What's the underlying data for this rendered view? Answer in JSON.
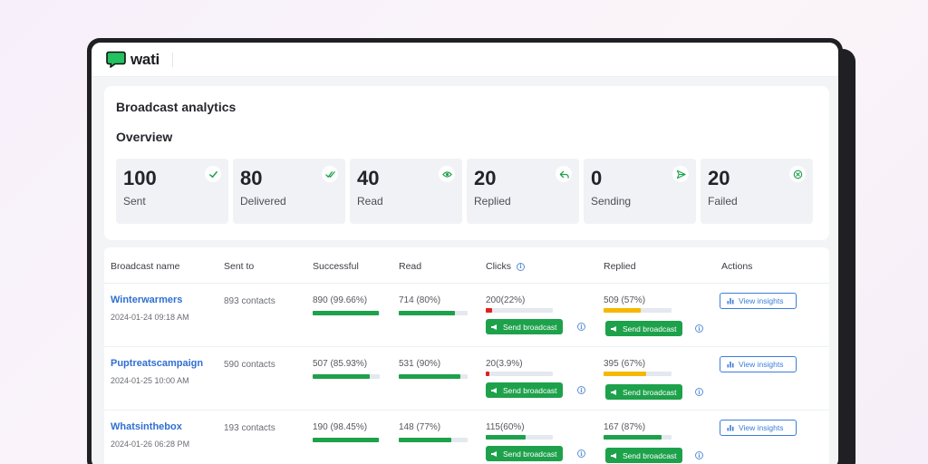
{
  "brand": {
    "name": "wati"
  },
  "page": {
    "title": "Broadcast analytics",
    "overview_title": "Overview"
  },
  "stats": [
    {
      "value": "100",
      "label": "Sent",
      "icon": "check-icon"
    },
    {
      "value": "80",
      "label": "Delivered",
      "icon": "double-check-icon"
    },
    {
      "value": "40",
      "label": "Read",
      "icon": "eye-icon"
    },
    {
      "value": "20",
      "label": "Replied",
      "icon": "reply-icon"
    },
    {
      "value": "0",
      "label": "Sending",
      "icon": "send-icon"
    },
    {
      "value": "20",
      "label": "Failed",
      "icon": "failed-icon"
    }
  ],
  "table": {
    "headers": {
      "name": "Broadcast name",
      "sent_to": "Sent to",
      "successful": "Successful",
      "read": "Read",
      "clicks": "Clicks",
      "replied": "Replied",
      "actions": "Actions"
    },
    "rows": [
      {
        "name": "Winterwarmers",
        "date": "2024-01-24 09:18 AM",
        "sent_to": "893 contacts",
        "successful": "890 (99.66%)",
        "successful_fraction": 0.99,
        "read": "714 (80%)",
        "read_fraction": 0.82,
        "clicks": "200(22%)",
        "clicks_fraction": 0.1,
        "clicks_color": "#e02020",
        "replied": "509 (57%)",
        "replied_fraction": 0.55,
        "replied_color": "#f5b800",
        "send_label": "Send broadcast",
        "action_label": "View insights"
      },
      {
        "name": "Puptreatscampaign",
        "date": "2024-01-25 10:00 AM",
        "sent_to": "590 contacts",
        "successful": "507 (85.93%)",
        "successful_fraction": 0.85,
        "read": "531 (90%)",
        "read_fraction": 0.9,
        "clicks": "20(3.9%)",
        "clicks_fraction": 0.05,
        "clicks_color": "#e02020",
        "replied": "395 (67%)",
        "replied_fraction": 0.62,
        "replied_color": "#f5b800",
        "send_label": "Send broadcast",
        "action_label": "View insights"
      },
      {
        "name": "Whatsinthebox",
        "date": "2024-01-26 06:28 PM",
        "sent_to": "193 contacts",
        "successful": "190 (98.45%)",
        "successful_fraction": 0.99,
        "read": "148 (77%)",
        "read_fraction": 0.76,
        "clicks": "115(60%)",
        "clicks_fraction": 0.6,
        "clicks_color": "#1ea14b",
        "replied": "167 (87%)",
        "replied_fraction": 0.85,
        "replied_color": "#1ea14b",
        "send_label": "Send broadcast",
        "action_label": "View insights"
      }
    ]
  },
  "colors": {
    "accent_green": "#1ea14b",
    "link_blue": "#2f6fd1",
    "warning_yellow": "#f5b800",
    "error_red": "#e02020"
  }
}
